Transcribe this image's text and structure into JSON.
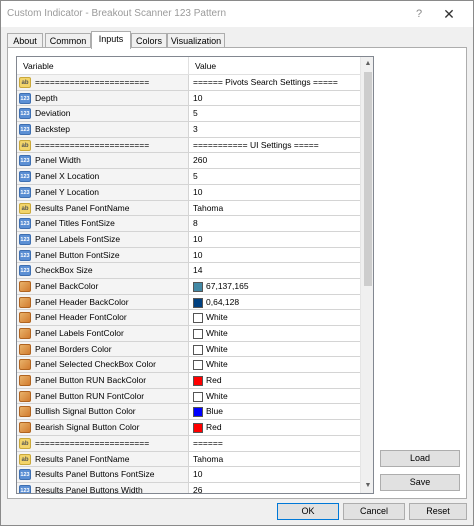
{
  "window": {
    "title": "Custom Indicator - Breakout Scanner 123 Pattern",
    "help_glyph": "?",
    "close_glyph": "✕"
  },
  "tabs": [
    {
      "label": "About",
      "active": false
    },
    {
      "label": "Common",
      "active": false
    },
    {
      "label": "Inputs",
      "active": true
    },
    {
      "label": "Colors",
      "active": false
    },
    {
      "label": "Visualization",
      "active": false
    }
  ],
  "grid": {
    "header_variable": "Variable",
    "header_value": "Value",
    "rows": [
      {
        "type": "str",
        "variable": "=======================",
        "value": "====== Pivots Search Settings ====="
      },
      {
        "type": "num",
        "variable": "Depth",
        "value": "10"
      },
      {
        "type": "num",
        "variable": "Deviation",
        "value": "5"
      },
      {
        "type": "num",
        "variable": "Backstep",
        "value": "3"
      },
      {
        "type": "str",
        "variable": "=======================",
        "value": "=========== UI Settings ====="
      },
      {
        "type": "num",
        "variable": "Panel Width",
        "value": "260"
      },
      {
        "type": "num",
        "variable": "Panel X Location",
        "value": "5"
      },
      {
        "type": "num",
        "variable": "Panel Y Location",
        "value": "10"
      },
      {
        "type": "str",
        "variable": "Results Panel FontName",
        "value": "Tahoma"
      },
      {
        "type": "num",
        "variable": "Panel Titles FontSize",
        "value": "8"
      },
      {
        "type": "num",
        "variable": "Panel Labels FontSize",
        "value": "10"
      },
      {
        "type": "num",
        "variable": "Panel Button FontSize",
        "value": "10"
      },
      {
        "type": "num",
        "variable": "CheckBox Size",
        "value": "14"
      },
      {
        "type": "col",
        "variable": "Panel BackColor",
        "value": "67,137,165",
        "swatch": "#4389a5"
      },
      {
        "type": "col",
        "variable": "Panel Header BackColor",
        "value": "0,64,128",
        "swatch": "#004080"
      },
      {
        "type": "col",
        "variable": "Panel Header FontColor",
        "value": "White",
        "swatch": "#ffffff"
      },
      {
        "type": "col",
        "variable": "Panel Labels FontColor",
        "value": "White",
        "swatch": "#ffffff"
      },
      {
        "type": "col",
        "variable": "Panel Borders Color",
        "value": "White",
        "swatch": "#ffffff"
      },
      {
        "type": "col",
        "variable": "Panel Selected CheckBox Color",
        "value": "White",
        "swatch": "#ffffff"
      },
      {
        "type": "col",
        "variable": "Panel Button RUN BackColor",
        "value": "Red",
        "swatch": "#ff0000"
      },
      {
        "type": "col",
        "variable": "Panel Button RUN FontColor",
        "value": "White",
        "swatch": "#ffffff"
      },
      {
        "type": "col",
        "variable": "Bullish Signal Button Color",
        "value": "Blue",
        "swatch": "#0000ff"
      },
      {
        "type": "col",
        "variable": "Bearish Signal Button Color",
        "value": "Red",
        "swatch": "#ff0000"
      },
      {
        "type": "str",
        "variable": "=======================",
        "value": "======"
      },
      {
        "type": "str",
        "variable": "Results Panel FontName",
        "value": "Tahoma"
      },
      {
        "type": "num",
        "variable": "Results Panel Buttons FontSize",
        "value": "10"
      },
      {
        "type": "num",
        "variable": "Results Panel Buttons Width",
        "value": "26"
      }
    ]
  },
  "scrollbar": {
    "up": "▲",
    "down": "▼"
  },
  "side_buttons": {
    "load": "Load",
    "save": "Save"
  },
  "footer_buttons": {
    "ok": "OK",
    "cancel": "Cancel",
    "reset": "Reset"
  },
  "icons": {
    "num": "123",
    "str": "ab"
  }
}
